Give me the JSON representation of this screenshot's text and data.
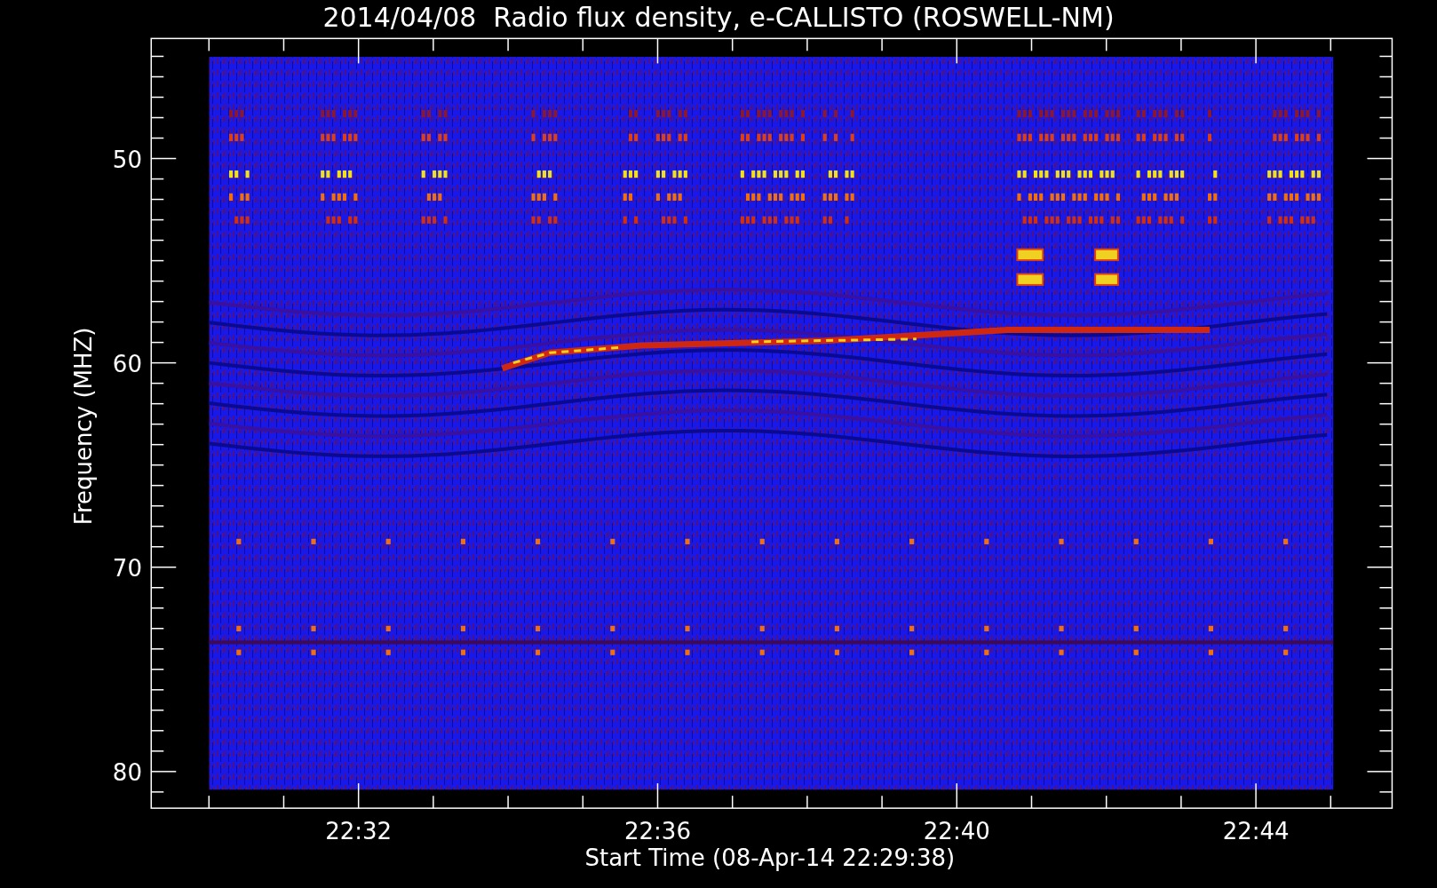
{
  "plot": {
    "title": "2014/04/08  Radio flux density, e-CALLISTO (ROSWELL-NM)",
    "ylabel": "Frequency (MHZ)",
    "xlabel": "Start Time (08-Apr-14 22:29:38)",
    "yticks": [
      "50",
      "60",
      "70",
      "80"
    ],
    "xticks": [
      "22:32",
      "22:36",
      "22:40",
      "22:44"
    ]
  }
}
